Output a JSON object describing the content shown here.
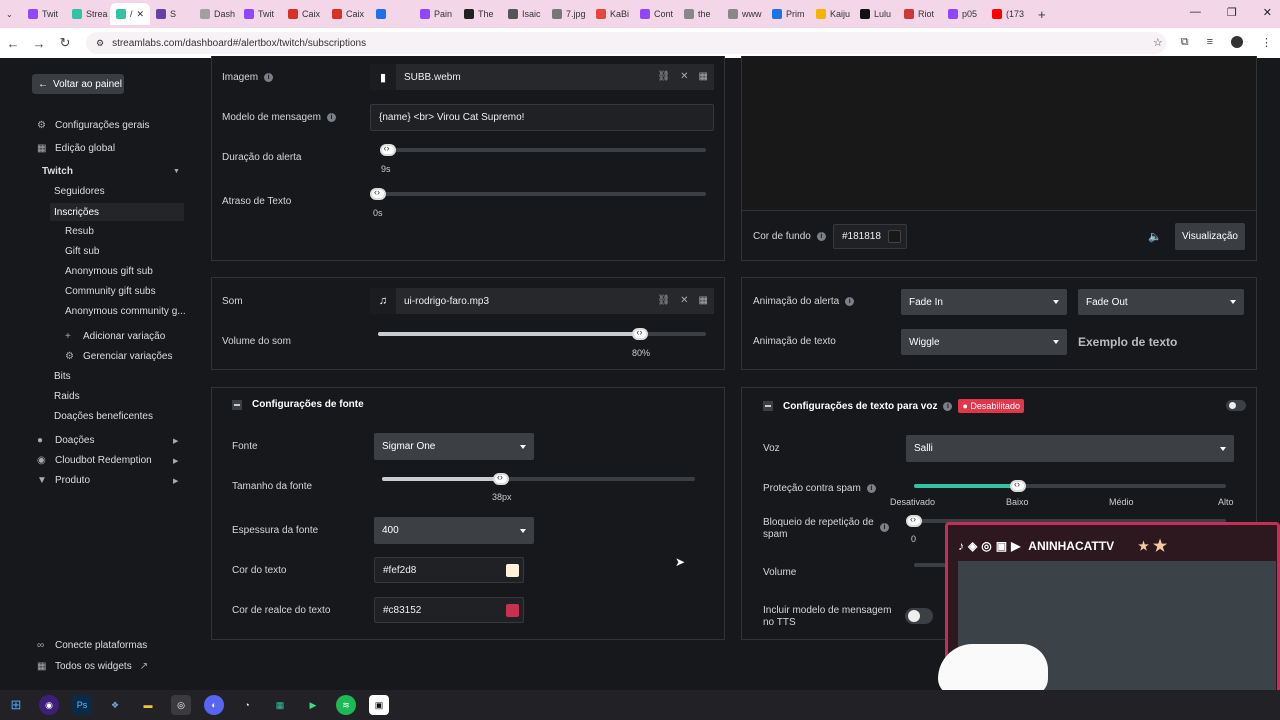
{
  "browser": {
    "tabs": [
      {
        "label": "Twit",
        "color": "#9146ff"
      },
      {
        "label": "Strea",
        "color": "#31c3a2"
      },
      {
        "label": "/",
        "color": "#31c3a2",
        "active": true
      },
      {
        "label": "S",
        "color": "#6441a5"
      },
      {
        "label": "Dash",
        "color": "#a0a0a0"
      },
      {
        "label": "Twit",
        "color": "#9146ff"
      },
      {
        "label": "Caix",
        "color": "#d93025"
      },
      {
        "label": "Caix",
        "color": "#d93025"
      },
      {
        "label": "",
        "color": "#1a73e8"
      },
      {
        "label": "Pain",
        "color": "#9146ff"
      },
      {
        "label": "The",
        "color": "#222"
      },
      {
        "label": "Isaic",
        "color": "#555"
      },
      {
        "label": "7.jpg",
        "color": "#777"
      },
      {
        "label": "KaBi",
        "color": "#e8453c"
      },
      {
        "label": "Cont",
        "color": "#9146ff"
      },
      {
        "label": "the",
        "color": "#888"
      },
      {
        "label": "www",
        "color": "#888"
      },
      {
        "label": "Prim",
        "color": "#1a73e8"
      },
      {
        "label": "Kaiju",
        "color": "#f4b400"
      },
      {
        "label": "Lulu",
        "color": "#111"
      },
      {
        "label": "Riot",
        "color": "#d13639"
      },
      {
        "label": "p05",
        "color": "#9146ff"
      },
      {
        "label": "(173",
        "color": "#ff0000"
      }
    ],
    "url": "streamlabs.com/dashboard#/alertbox/twitch/subscriptions"
  },
  "sidebar": {
    "back": "Voltar ao painel",
    "general": "Configurações gerais",
    "global": "Edição global",
    "twitch": "Twitch",
    "followers": "Seguidores",
    "subs": "Inscrições",
    "resub": "Resub",
    "gift": "Gift sub",
    "anon_gift": "Anonymous gift sub",
    "community": "Community gift subs",
    "anon_community": "Anonymous community g...",
    "add_var": "Adicionar variação",
    "manage_var": "Gerenciar variações",
    "bits": "Bits",
    "raids": "Raids",
    "donations_benef": "Doações beneficentes",
    "donations": "Doações",
    "cloudbot": "Cloudbot Redemption",
    "product": "Produto",
    "connect": "Conecte plataformas",
    "all_widgets": "Todos os widgets"
  },
  "alert": {
    "image_label": "Imagem",
    "image_file": "SUBB.webm",
    "msg_label": "Modelo de mensagem",
    "msg_value": "{name} <br> Virou Cat Supremo!",
    "duration_label": "Duração do alerta",
    "duration_value": "9s",
    "duration_fill": 0.02,
    "delay_label": "Atraso de Texto",
    "delay_value": "0s",
    "delay_fill": 0.0,
    "sound_label": "Som",
    "sound_file": "ui-rodrigo-faro.mp3",
    "volume_label": "Volume do som",
    "volume_value": "80%",
    "volume_fill": 0.8
  },
  "preview": {
    "bg_label": "Cor de fundo",
    "bg_value": "#181818",
    "preview_btn": "Visualização",
    "anim_label": "Animação do alerta",
    "anim_in": "Fade In",
    "anim_out": "Fade Out",
    "text_anim_label": "Animação de texto",
    "text_anim": "Wiggle",
    "example": "Exemplo de texto"
  },
  "font": {
    "header": "Configurações de fonte",
    "font_label": "Fonte",
    "font_value": "Sigmar One",
    "size_label": "Tamanho da fonte",
    "size_value": "38px",
    "size_fill": 0.38,
    "weight_label": "Espessura da fonte",
    "weight_value": "400",
    "color_label": "Cor do texto",
    "color_value": "#fef2d8",
    "highlight_label": "Cor de realce do texto",
    "highlight_value": "#c83152"
  },
  "tts": {
    "header": "Configurações de texto para voz",
    "badge": "Desabilitado",
    "voice_label": "Voz",
    "voice_value": "Salli",
    "spam_label": "Proteção contra spam",
    "spam_ticks": [
      "Desativado",
      "Baixo",
      "Médio",
      "Alto"
    ],
    "spam_level": "Baixo",
    "repeat_label": "Bloqueio de repetição de spam",
    "repeat_value": "0",
    "volume_label": "Volume",
    "include_label": "Incluir modelo de mensagem no TTS"
  },
  "overlay": {
    "banner": "ANINHACATTV"
  },
  "colors": {
    "accent": "#31c3a2",
    "danger": "#e0374b",
    "text_color": "#fef2d8",
    "highlight": "#c83152"
  }
}
